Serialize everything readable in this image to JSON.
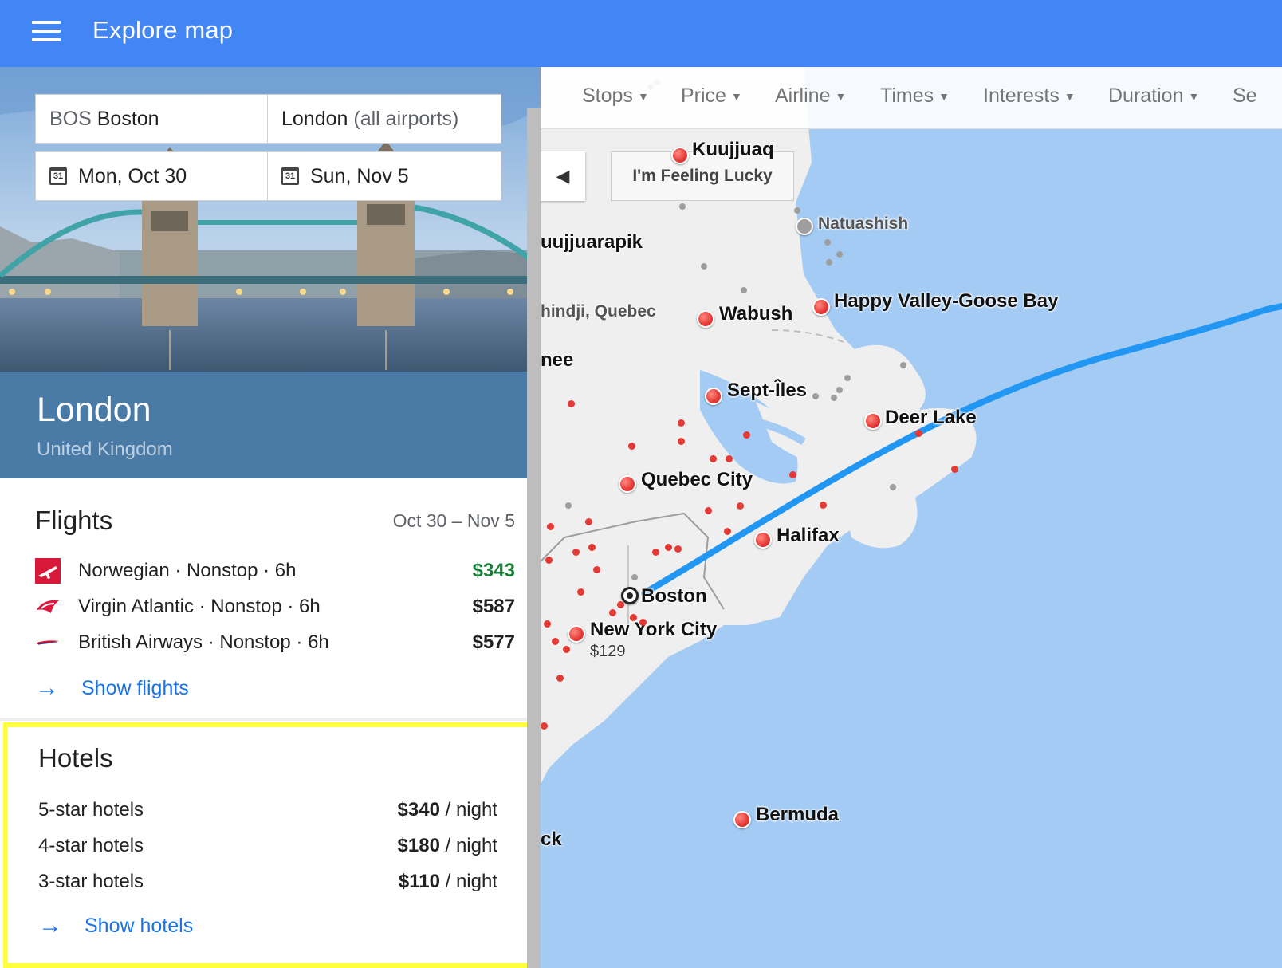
{
  "header": {
    "title": "Explore map"
  },
  "search": {
    "origin_code": "BOS",
    "origin_city": "Boston",
    "destination": "London",
    "destination_suffix": "(all airports)",
    "depart_date": "Mon, Oct 30",
    "return_date": "Sun, Nov 5",
    "calendar_glyph": "31"
  },
  "destination": {
    "city": "London",
    "country": "United Kingdom"
  },
  "flights": {
    "title": "Flights",
    "dates": "Oct 30 – Nov 5",
    "rows": [
      {
        "airline": "Norwegian · Nonstop · 6h",
        "price": "$343",
        "price_color": "#188038",
        "logo": "norwegian-logo-icon"
      },
      {
        "airline": "Virgin Atlantic · Nonstop · 6h",
        "price": "$587",
        "price_color": "#212121",
        "logo": "virgin-atlantic-logo-icon"
      },
      {
        "airline": "British Airways · Nonstop · 6h",
        "price": "$577",
        "price_color": "#212121",
        "logo": "british-airways-logo-icon"
      }
    ],
    "show_link": "Show flights"
  },
  "hotels": {
    "title": "Hotels",
    "rows": [
      {
        "label": "5-star hotels",
        "price": "$340",
        "unit": "/ night"
      },
      {
        "label": "4-star hotels",
        "price": "$180",
        "unit": "/ night"
      },
      {
        "label": "3-star hotels",
        "price": "$110",
        "unit": "/ night"
      }
    ],
    "show_link": "Show hotels",
    "highlight_color": "#ffff3d"
  },
  "map": {
    "filters": [
      "Stops",
      "Price",
      "Airline",
      "Times",
      "Interests",
      "Duration",
      "Se"
    ],
    "lucky_button": "I'm Feeling Lucky",
    "collapse_icon": "chevron-left-icon",
    "places": {
      "kuujjuaq": "Kuujjuaq",
      "natuashish": "Natuashish",
      "kuujjuarapik": "uujjuarapik",
      "chibougamau": "hindji, Quebec",
      "wabush": "Wabush",
      "goose_bay": "Happy Valley-Goose Bay",
      "nee": "nee",
      "sept_iles": "Sept-Îles",
      "deer_lake": "Deer Lake",
      "quebec": "Quebec City",
      "halifax": "Halifax",
      "boston": "Boston",
      "nyc": "New York City",
      "nyc_price": "$129",
      "bermuda": "Bermuda",
      "ck": "ck"
    },
    "colors": {
      "water": "#a4cbf3",
      "land": "#efefef",
      "route": "#2196f3"
    }
  }
}
